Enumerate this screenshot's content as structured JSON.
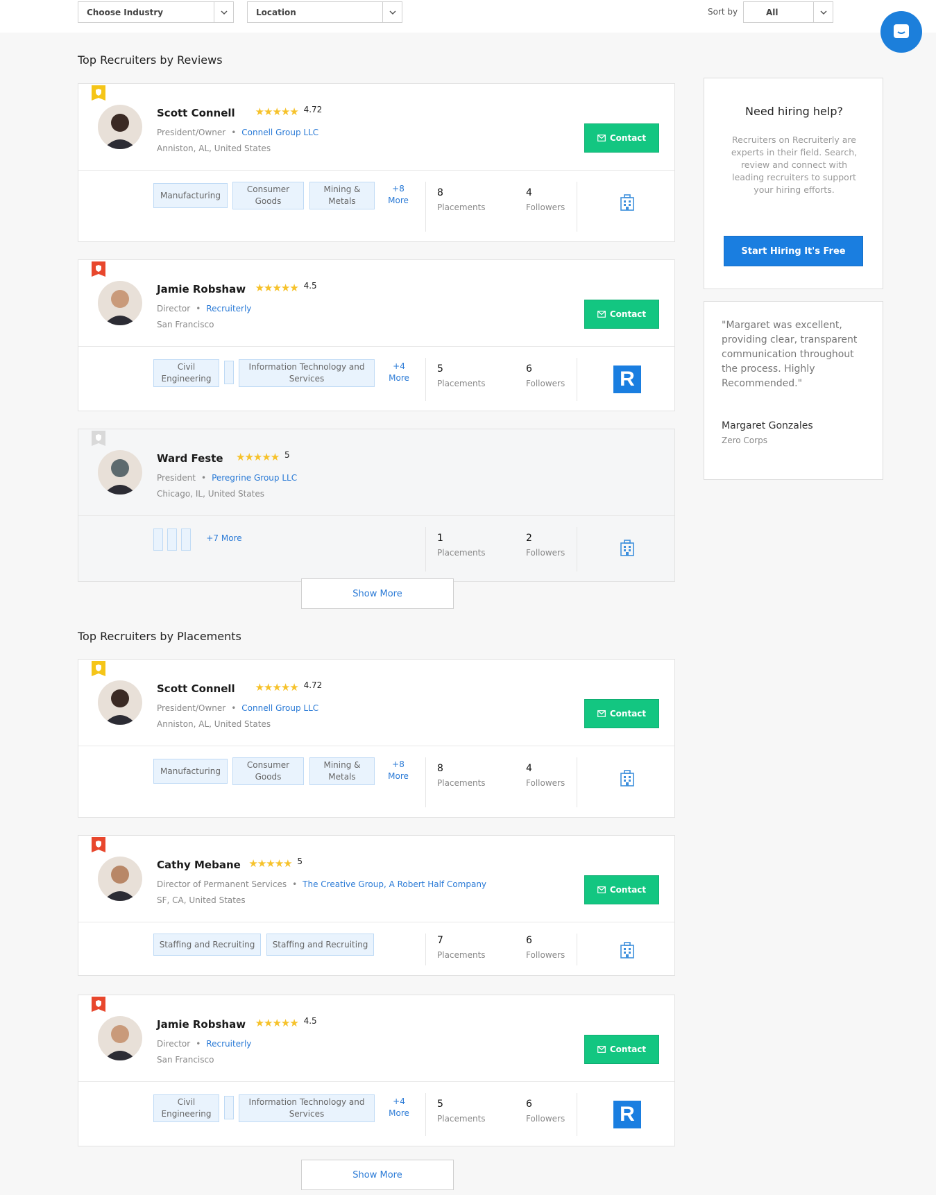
{
  "filters": {
    "industry": "Choose Industry",
    "location": "Location",
    "sort_label": "Sort by",
    "sort_value": "All"
  },
  "sections": [
    {
      "title": "Top Recruiters by Reviews",
      "show_more": "Show More"
    },
    {
      "title": "Top Recruiters by Placements",
      "show_more": "Show More"
    }
  ],
  "cards": [
    {
      "badge_color": "#f5c518",
      "name": "Scott Connell",
      "stars": "★★★★★",
      "rating": "4.72",
      "role": "President/Owner",
      "company": "Connell Group LLC",
      "location": "Anniston, AL, United States",
      "contact": "Contact",
      "tags": [
        "Manufacturing",
        "Consumer Goods",
        "Mining & Metals"
      ],
      "more": "+8 More",
      "placements": "8",
      "placements_label": "Placements",
      "followers": "4",
      "followers_label": "Followers",
      "logo": "building-icon"
    },
    {
      "badge_color": "#e8472d",
      "name": "Jamie Robshaw",
      "stars": "★★★★★",
      "rating": "4.5",
      "role": "Director",
      "company": "Recruiterly",
      "location": "San Francisco",
      "contact": "Contact",
      "tags": [
        "Civil Engineering",
        "",
        "Information Technology and Services"
      ],
      "more": "+4 More",
      "placements": "5",
      "placements_label": "Placements",
      "followers": "6",
      "followers_label": "Followers",
      "logo": "R"
    },
    {
      "badge_color": "#d9d9d9",
      "name": "Ward Feste",
      "stars": "★★★★★",
      "rating": "5",
      "role": "President",
      "company": "Peregrine Group LLC",
      "location": "Chicago, IL, United States",
      "tags": [
        "",
        "",
        ""
      ],
      "more": "+7 More",
      "placements": "1",
      "placements_label": "Placements",
      "followers": "2",
      "followers_label": "Followers",
      "logo": "building-icon"
    },
    {
      "badge_color": "#f5c518",
      "name": "Scott Connell",
      "stars": "★★★★★",
      "rating": "4.72",
      "role": "President/Owner",
      "company": "Connell Group LLC",
      "location": "Anniston, AL, United States",
      "contact": "Contact",
      "tags": [
        "Manufacturing",
        "Consumer Goods",
        "Mining & Metals"
      ],
      "more": "+8 More",
      "placements": "8",
      "placements_label": "Placements",
      "followers": "4",
      "followers_label": "Followers",
      "logo": "building-icon"
    },
    {
      "badge_color": "#e8472d",
      "name": "Cathy Mebane",
      "stars": "★★★★★",
      "rating": "5",
      "role": "Director of Permanent Services",
      "company": "The Creative Group, A Robert Half Company",
      "location": "SF, CA, United States",
      "contact": "Contact",
      "tags": [
        "Staffing and Recruiting",
        "Staffing and Recruiting"
      ],
      "placements": "7",
      "placements_label": "Placements",
      "followers": "6",
      "followers_label": "Followers",
      "logo": "building-icon"
    },
    {
      "badge_color": "#e8472d",
      "name": "Jamie Robshaw",
      "stars": "★★★★★",
      "rating": "4.5",
      "role": "Director",
      "company": "Recruiterly",
      "location": "San Francisco",
      "contact": "Contact",
      "tags": [
        "Civil Engineering",
        "",
        "Information Technology and Services"
      ],
      "more": "+4 More",
      "placements": "5",
      "placements_label": "Placements",
      "followers": "6",
      "followers_label": "Followers",
      "logo": "R"
    }
  ],
  "sidebar": {
    "help_title": "Need hiring help?",
    "help_text": "Recruiters on Recruiterly are experts in their field. Search, review and connect with leading recruiters to support your hiring efforts.",
    "hire_button": "Start Hiring It's Free",
    "quote": "\"Margaret was excellent, providing clear, transparent communication throughout the process. Highly Recommended.\"",
    "quote_name": "Margaret Gonzales",
    "quote_company": "Zero Corps"
  },
  "colors": {
    "accent_blue": "#1a7ee0",
    "contact_green": "#13c681",
    "tag_bg": "#e9f3fd",
    "star": "#f6c22b"
  }
}
